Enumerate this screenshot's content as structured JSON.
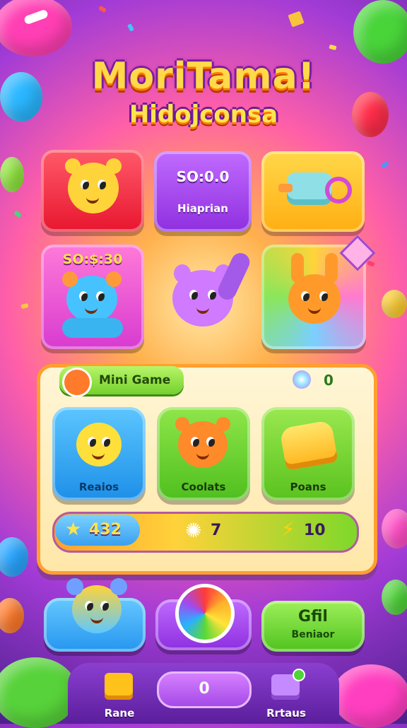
{
  "title": {
    "main": "MoriTama!",
    "sub": "Hidojconsa"
  },
  "top_tiles": [
    {
      "kind": "character-tile",
      "color": "#ff3a4d",
      "label": ""
    },
    {
      "kind": "text-tile",
      "color": "#a53ff0",
      "heading": "SO:0.0",
      "label": "Hiaprian"
    },
    {
      "kind": "item-tile",
      "color": "#ffc21a",
      "label": ""
    }
  ],
  "mid_tiles": [
    {
      "kind": "character-tile",
      "color": "#ff4fd0",
      "heading": "SO:$:30"
    },
    {
      "kind": "character-center",
      "color": "#c86bff"
    },
    {
      "kind": "character-tile",
      "color": "#ffbf2a"
    }
  ],
  "mini_game": {
    "header_label": "Mini Game",
    "counter_value": "0",
    "cards": [
      {
        "label": "Reaios",
        "color": "#27a6ff"
      },
      {
        "label": "Coolats",
        "color": "#5fd42a"
      },
      {
        "label": "Poans",
        "color": "#6bd62a"
      }
    ],
    "stats": [
      {
        "icon": "star-icon",
        "value": "432"
      },
      {
        "icon": "sparkle-icon",
        "value": "7"
      },
      {
        "icon": "lightning-icon",
        "value": "10"
      }
    ]
  },
  "bottom_buttons": [
    {
      "label": "",
      "color": "#39b7ff"
    },
    {
      "label": "",
      "color": "#a747f0"
    },
    {
      "label": "Gfil",
      "sub": "Beniaor",
      "color": "#64d236"
    }
  ],
  "nav": {
    "left_label": "Rane",
    "center_value": "0",
    "right_label": "Rrtaus"
  },
  "colors": {
    "panel_border": "#ff9f2e",
    "accent_yellow": "#ffd94a",
    "accent_purple": "#8a3a9c"
  }
}
